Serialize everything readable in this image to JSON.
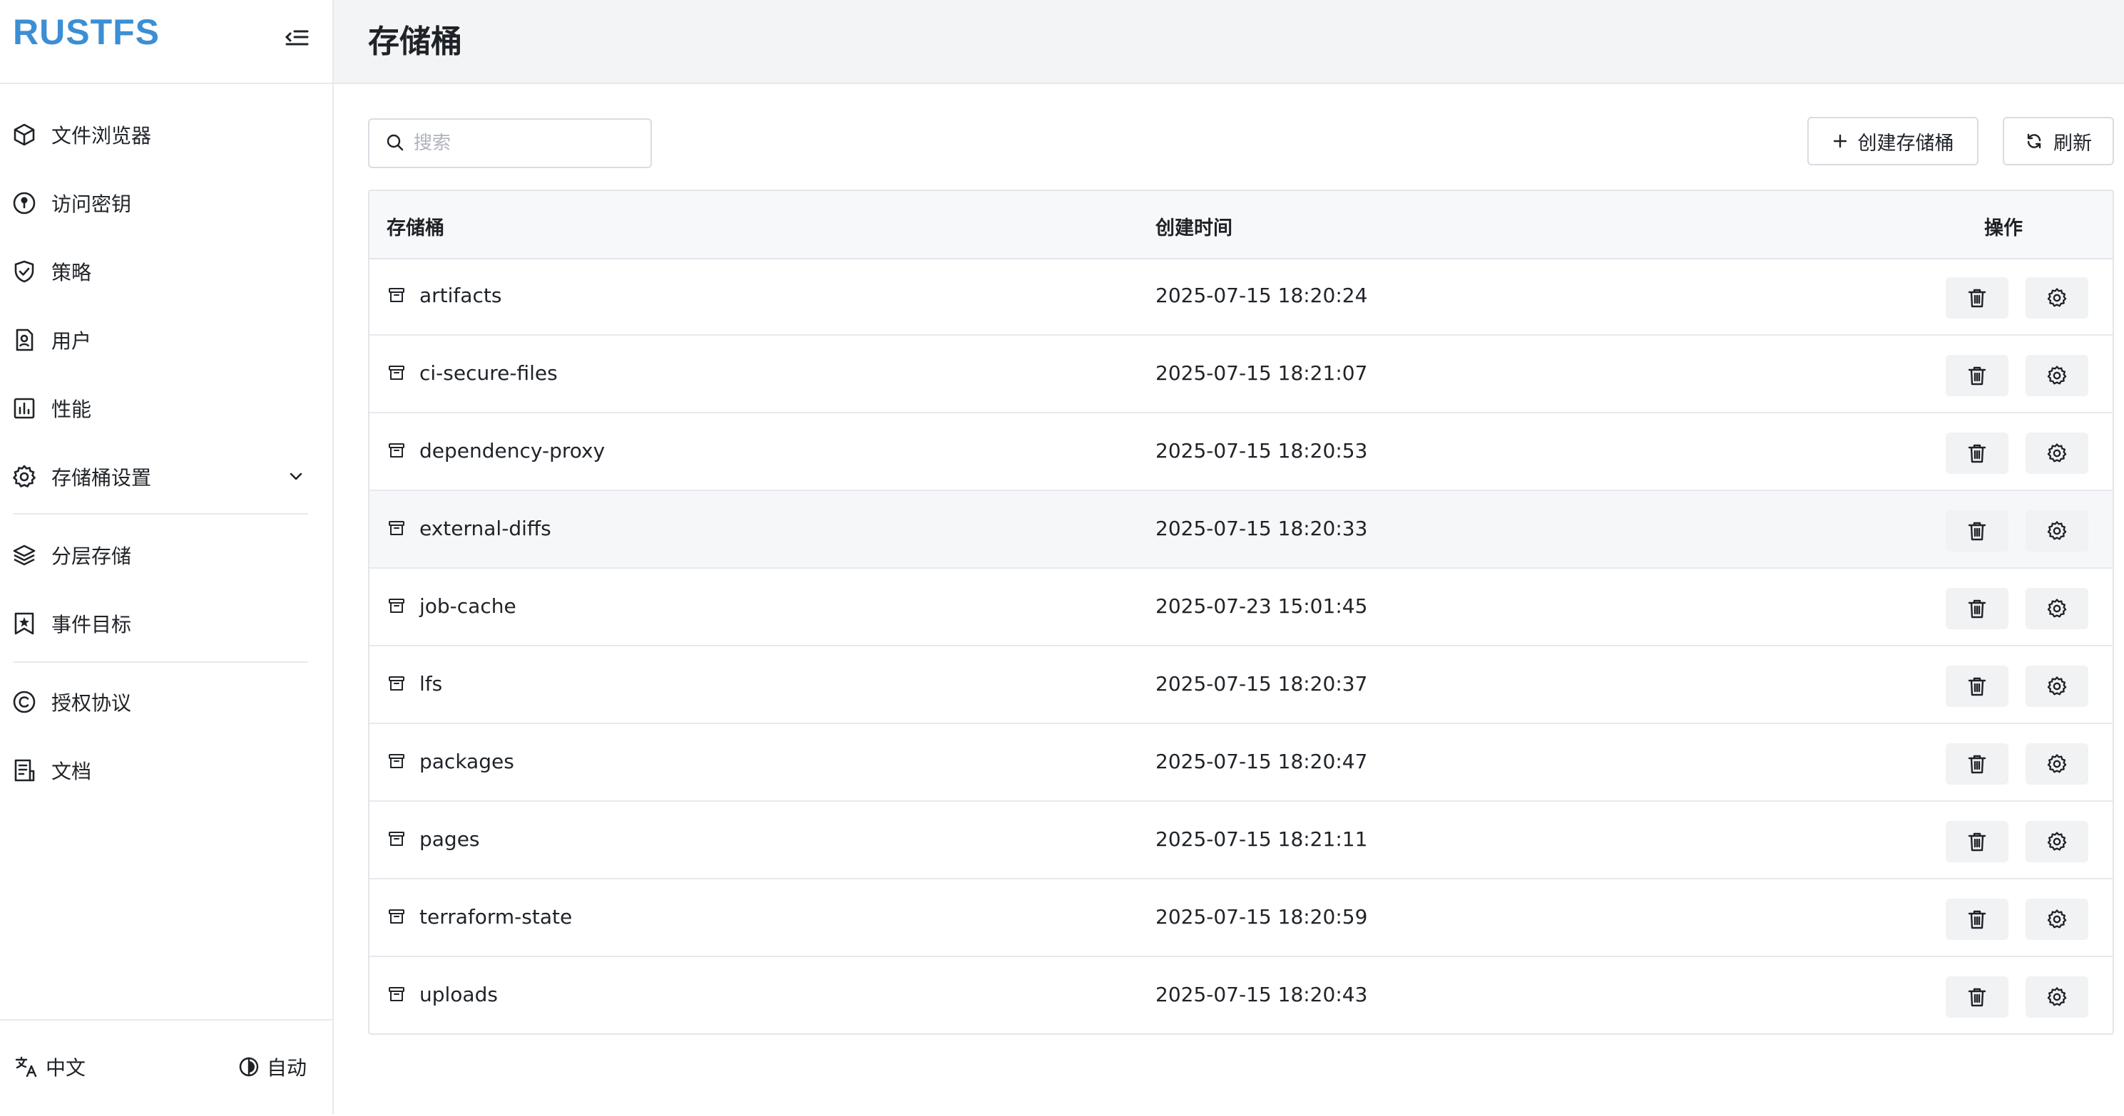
{
  "app": {
    "logo": "RUSTFS"
  },
  "sidebar": {
    "items": [
      {
        "label": "文件浏览器",
        "icon": "cube-icon"
      },
      {
        "label": "访问密钥",
        "icon": "key-icon"
      },
      {
        "label": "策略",
        "icon": "shield-check-icon"
      },
      {
        "label": "用户",
        "icon": "user-card-icon"
      },
      {
        "label": "性能",
        "icon": "bar-chart-icon"
      },
      {
        "label": "存储桶设置",
        "icon": "gear-icon"
      },
      {
        "label": "分层存储",
        "icon": "layers-icon"
      },
      {
        "label": "事件目标",
        "icon": "bookmark-star-icon"
      },
      {
        "label": "授权协议",
        "icon": "copyright-icon"
      },
      {
        "label": "文档",
        "icon": "document-icon"
      }
    ],
    "footer": {
      "language": "中文",
      "theme": "自动"
    }
  },
  "header": {
    "title": "存储桶"
  },
  "toolbar": {
    "search_placeholder": "搜索",
    "create_label": "创建存储桶",
    "refresh_label": "刷新"
  },
  "table": {
    "columns": {
      "bucket": "存储桶",
      "created": "创建时间",
      "actions": "操作"
    },
    "rows": [
      {
        "name": "artifacts",
        "created": "2025-07-15 18:20:24"
      },
      {
        "name": "ci-secure-files",
        "created": "2025-07-15 18:21:07"
      },
      {
        "name": "dependency-proxy",
        "created": "2025-07-15 18:20:53"
      },
      {
        "name": "external-diffs",
        "created": "2025-07-15 18:20:33"
      },
      {
        "name": "job-cache",
        "created": "2025-07-23 15:01:45"
      },
      {
        "name": "lfs",
        "created": "2025-07-15 18:20:37"
      },
      {
        "name": "packages",
        "created": "2025-07-15 18:20:47"
      },
      {
        "name": "pages",
        "created": "2025-07-15 18:21:11"
      },
      {
        "name": "terraform-state",
        "created": "2025-07-15 18:20:59"
      },
      {
        "name": "uploads",
        "created": "2025-07-15 18:20:43"
      }
    ]
  },
  "colors": {
    "brand": "#3b8fd4",
    "header_bg": "#f3f4f6",
    "row_hover": "#f6f7f9"
  }
}
